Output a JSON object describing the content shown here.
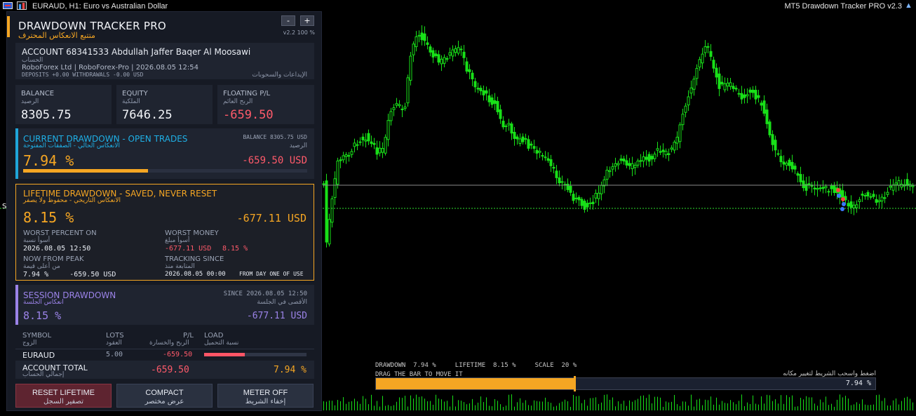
{
  "window": {
    "symbol_title": "EURAUD, H1:  Euro vs Australian Dollar",
    "ea_title": "MT5 Drawdown Tracker PRO v2.3"
  },
  "chart": {
    "line_color": "#aaaaaa",
    "candle_color": "#18e018",
    "side_marker": "S"
  },
  "panel": {
    "title": "DRAWDOWN TRACKER PRO",
    "title_ar": "متتبع الانعكاس المحترف",
    "minus": "-",
    "plus": "+",
    "version": "v2.2  100 %",
    "account": {
      "line1": "ACCOUNT  68341533  Abdullah Jaffer Baqer Al Moosawi",
      "line1_ar": "الحساب",
      "line2": "RoboForex Ltd  |  RoboForex-Pro  |  2026.08.05 12:54",
      "deposits": "DEPOSITS  +0.00     WITHDRAWALS  -0.00   USD",
      "deposits_ar": "الإيداعات والسحوبات"
    },
    "balance": {
      "label": "BALANCE",
      "label_ar": "الرصيد",
      "value": "8305.75"
    },
    "equity": {
      "label": "EQUITY",
      "label_ar": "الملكية",
      "value": "7646.25"
    },
    "floating": {
      "label": "FLOATING P/L",
      "label_ar": "الربح العائم",
      "value": "-659.50"
    },
    "current": {
      "title": "CURRENT DRAWDOWN - OPEN TRADES",
      "title_ar": "الانعكاس الحالي  -  الصفقات المفتوحة",
      "balance_lbl": "BALANCE  8305.75 USD",
      "balance_ar": "الرصيد",
      "pct": "7.94 %",
      "money": "-659.50 USD",
      "progress": 0.44
    },
    "lifetime": {
      "title": "LIFETIME DRAWDOWN - SAVED, NEVER RESET",
      "title_ar": "الانعكاس التاريخي - محفوظ ولا يصفر",
      "pct": "8.15 %",
      "money": "-677.11 USD",
      "worst_pct_lbl": "WORST PERCENT ON",
      "worst_pct_ar": "أسوأ نسبة",
      "worst_pct_val": "2026.08.05 12:50",
      "worst_money_lbl": "WORST MONEY",
      "worst_money_ar": "أسوأ مبلغ",
      "worst_money_val": "-677.11 USD",
      "worst_money_pct": "8.15 %",
      "peak_lbl": "NOW FROM PEAK",
      "peak_ar": "من أعلى قيمة",
      "peak_val": "7.94 %     -659.50 USD",
      "track_lbl": "TRACKING SINCE",
      "track_ar": "المتابعة منذ",
      "track_val": "2026.08.05 00:00",
      "track_note": "FROM DAY ONE OF USE"
    },
    "session": {
      "title": "SESSION DRAWDOWN",
      "title_ar": "انعكاس الجلسة",
      "since": "SINCE  2026.08.05 12:50",
      "since_ar": "الأقصى في الجلسة",
      "pct": "8.15 %",
      "money": "-677.11 USD"
    },
    "table": {
      "headers": [
        {
          "en": "SYMBOL",
          "ar": "الزوج"
        },
        {
          "en": "LOTS",
          "ar": "العقود"
        },
        {
          "en": "P/L",
          "ar": "الربح والخسارة"
        },
        {
          "en": "LOAD",
          "ar": "نسبة التحميل"
        }
      ],
      "row": {
        "symbol": "EURAUD",
        "lots": "5.00",
        "pl": "-659.50",
        "load": 0.4
      },
      "total_lbl": "ACCOUNT TOTAL",
      "total_ar": "إجمالي الحساب",
      "total_pl": "-659.50",
      "total_pct": "7.94 %"
    },
    "buttons": {
      "reset": "RESET LIFETIME",
      "reset_ar": "تصفير السجل",
      "compact": "COMPACT",
      "compact_ar": "عرض مختصر",
      "meter": "METER OFF",
      "meter_ar": "إخفاء الشريط"
    }
  },
  "meter": {
    "info": "DRAWDOWN  7.94 %     LIFETIME  8.15 %     SCALE  20 %",
    "drag": "DRAG THE BAR TO MOVE IT",
    "drag_ar": "اضغط واسحب الشريط لتغيير مكانه",
    "value": "7.94 %",
    "fill": 0.397
  }
}
